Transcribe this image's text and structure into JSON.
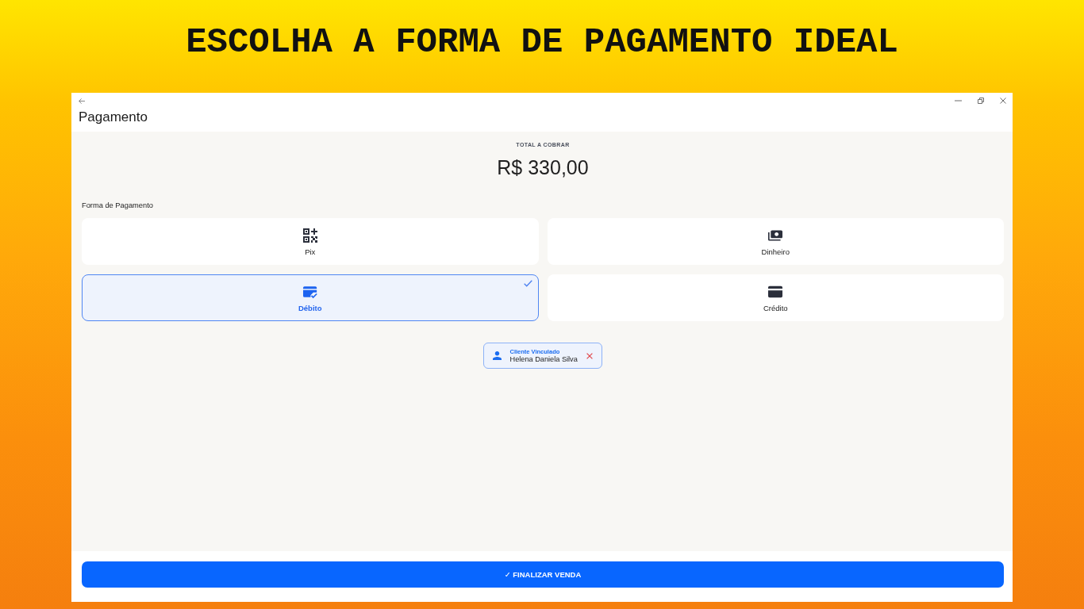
{
  "banner": {
    "title": "ESCOLHA A FORMA DE PAGAMENTO IDEAL"
  },
  "window": {
    "title": "Pagamento"
  },
  "total": {
    "label": "TOTAL A COBRAR",
    "amount": "R$ 330,00"
  },
  "payment": {
    "label": "Forma de Pagamento",
    "options": [
      {
        "kind": "pix",
        "label": "Pix",
        "selected": false
      },
      {
        "kind": "cash",
        "label": "Dinheiro",
        "selected": false
      },
      {
        "kind": "debit",
        "label": "Débito",
        "selected": true
      },
      {
        "kind": "credit",
        "label": "Crédito",
        "selected": false
      }
    ]
  },
  "client": {
    "label": "Cliente Vinculado",
    "name": "Helena Daniela Silva"
  },
  "finish_button": {
    "label": "✓ FINALIZAR VENDA"
  }
}
